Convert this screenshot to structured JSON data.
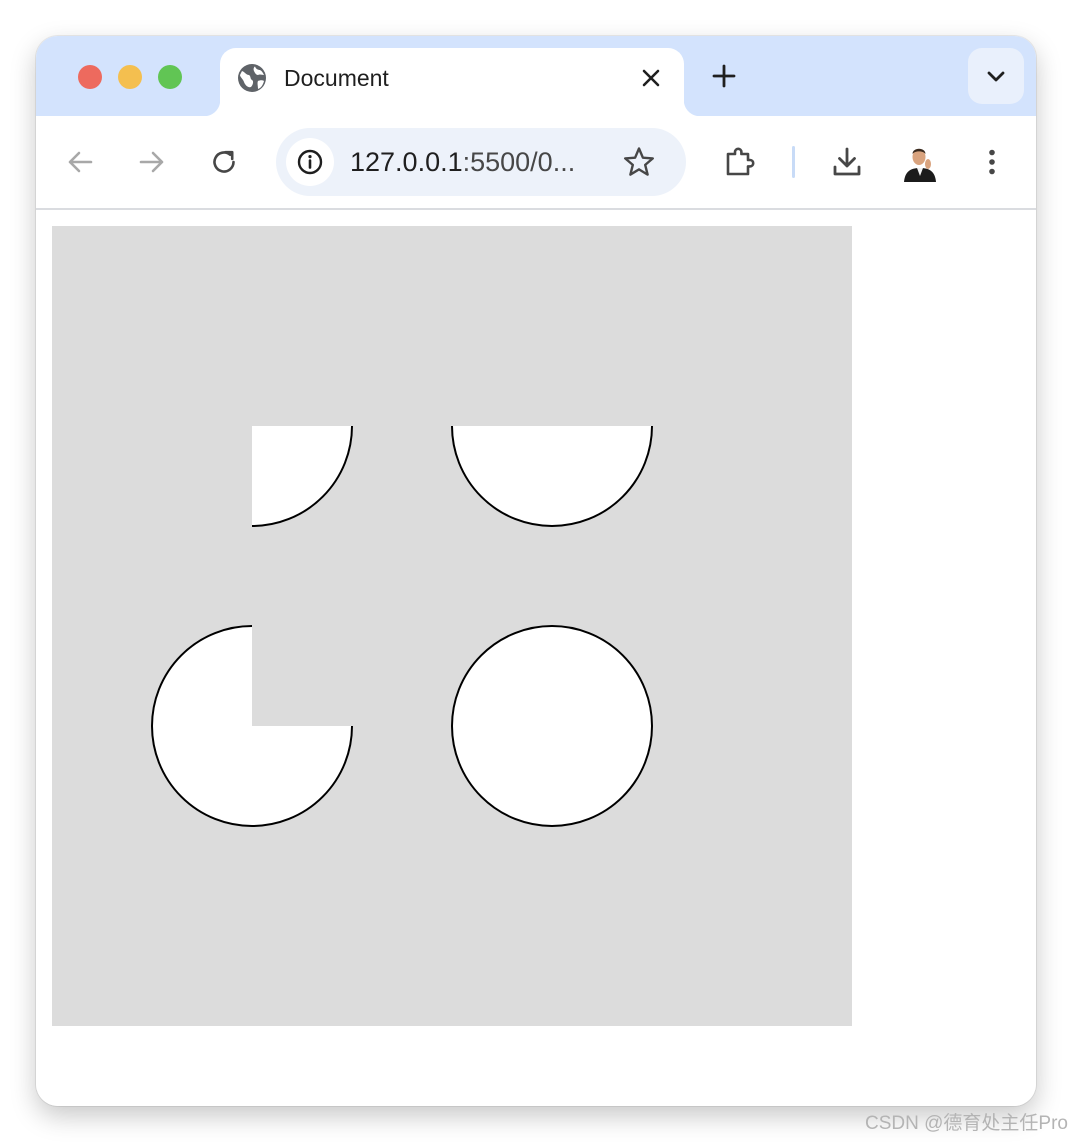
{
  "window": {
    "controls": {
      "close_color": "#ed6a5e",
      "minimize_color": "#f4bf4f",
      "zoom_color": "#61c554"
    }
  },
  "tab": {
    "title": "Document",
    "favicon": "globe-icon",
    "close_icon": "close-icon"
  },
  "toolbar": {
    "back_icon": "arrow-left-icon",
    "forward_icon": "arrow-right-icon",
    "reload_icon": "reload-icon",
    "address": {
      "host": "127.0.0.1",
      "rest": ":5500/0...",
      "info_icon": "info-icon",
      "bookmark_icon": "star-icon"
    },
    "extensions_icon": "puzzle-icon",
    "downloads_icon": "download-icon",
    "menu_icon": "more-vert-icon"
  },
  "page": {
    "canvas": {
      "background": "#dcdcdc",
      "shape_fill": "#ffffff",
      "shape_stroke": "#000000",
      "shapes": [
        {
          "name": "quarter-circle",
          "sweep_degrees": 90
        },
        {
          "name": "half-circle",
          "sweep_degrees": 180
        },
        {
          "name": "three-quarter-circle",
          "sweep_degrees": 270
        },
        {
          "name": "full-circle",
          "sweep_degrees": 360
        }
      ]
    }
  },
  "watermark": "CSDN @德育处主任Pro"
}
